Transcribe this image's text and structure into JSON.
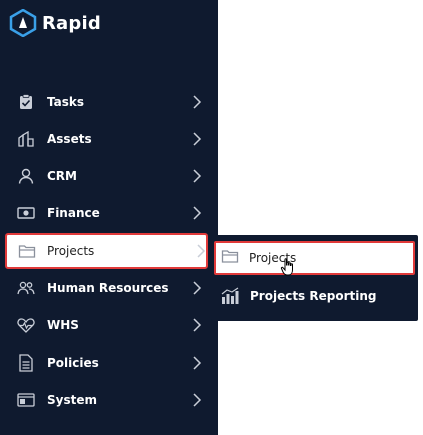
{
  "brand": {
    "name": "Rapid",
    "accent": "#3aa0e8"
  },
  "colors": {
    "sidebar_bg": "#0f1a2f",
    "highlight_border": "#e13a3a",
    "text_light": "#ffffff"
  },
  "sidebar": {
    "items": [
      {
        "label": "Tasks",
        "icon": "clipboard-check-icon"
      },
      {
        "label": "Assets",
        "icon": "assets-icon"
      },
      {
        "label": "CRM",
        "icon": "user-icon"
      },
      {
        "label": "Finance",
        "icon": "money-icon"
      },
      {
        "label": "Projects",
        "icon": "folder-icon",
        "active": true
      },
      {
        "label": "Human Resources",
        "icon": "people-icon"
      },
      {
        "label": "WHS",
        "icon": "heart-pulse-icon"
      },
      {
        "label": "Policies",
        "icon": "document-icon"
      },
      {
        "label": "System",
        "icon": "system-icon"
      }
    ]
  },
  "submenu": {
    "items": [
      {
        "label": "Projects",
        "icon": "folder-icon",
        "active": true
      },
      {
        "label": "Projects Reporting",
        "icon": "bar-chart-icon"
      }
    ]
  }
}
